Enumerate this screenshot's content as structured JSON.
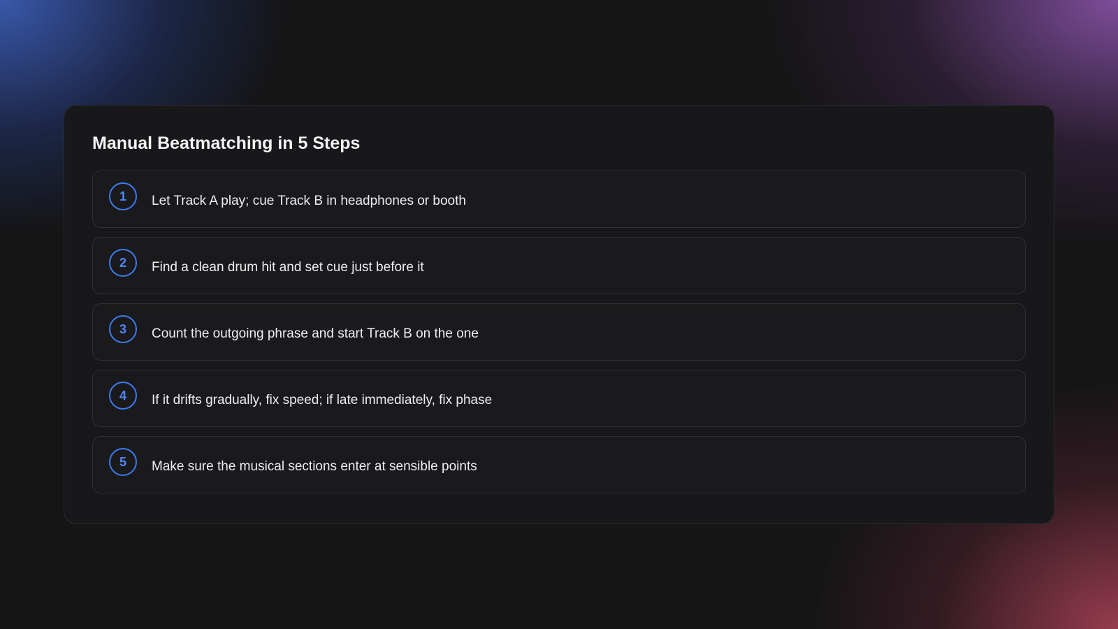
{
  "title": "Manual Beatmatching in 5 Steps",
  "colors": {
    "accent": "#3d7bf2",
    "background": "#151516",
    "card": "#18181a",
    "step_border": "#303035"
  },
  "steps": [
    {
      "number": "1",
      "text": "Let Track A play; cue Track B in headphones or booth"
    },
    {
      "number": "2",
      "text": "Find a clean drum hit and set cue just before it"
    },
    {
      "number": "3",
      "text": "Count the outgoing phrase and start Track B on the one"
    },
    {
      "number": "4",
      "text": "If it drifts gradually, fix speed; if late immediately, fix phase"
    },
    {
      "number": "5",
      "text": "Make sure the musical sections enter at sensible points"
    }
  ]
}
